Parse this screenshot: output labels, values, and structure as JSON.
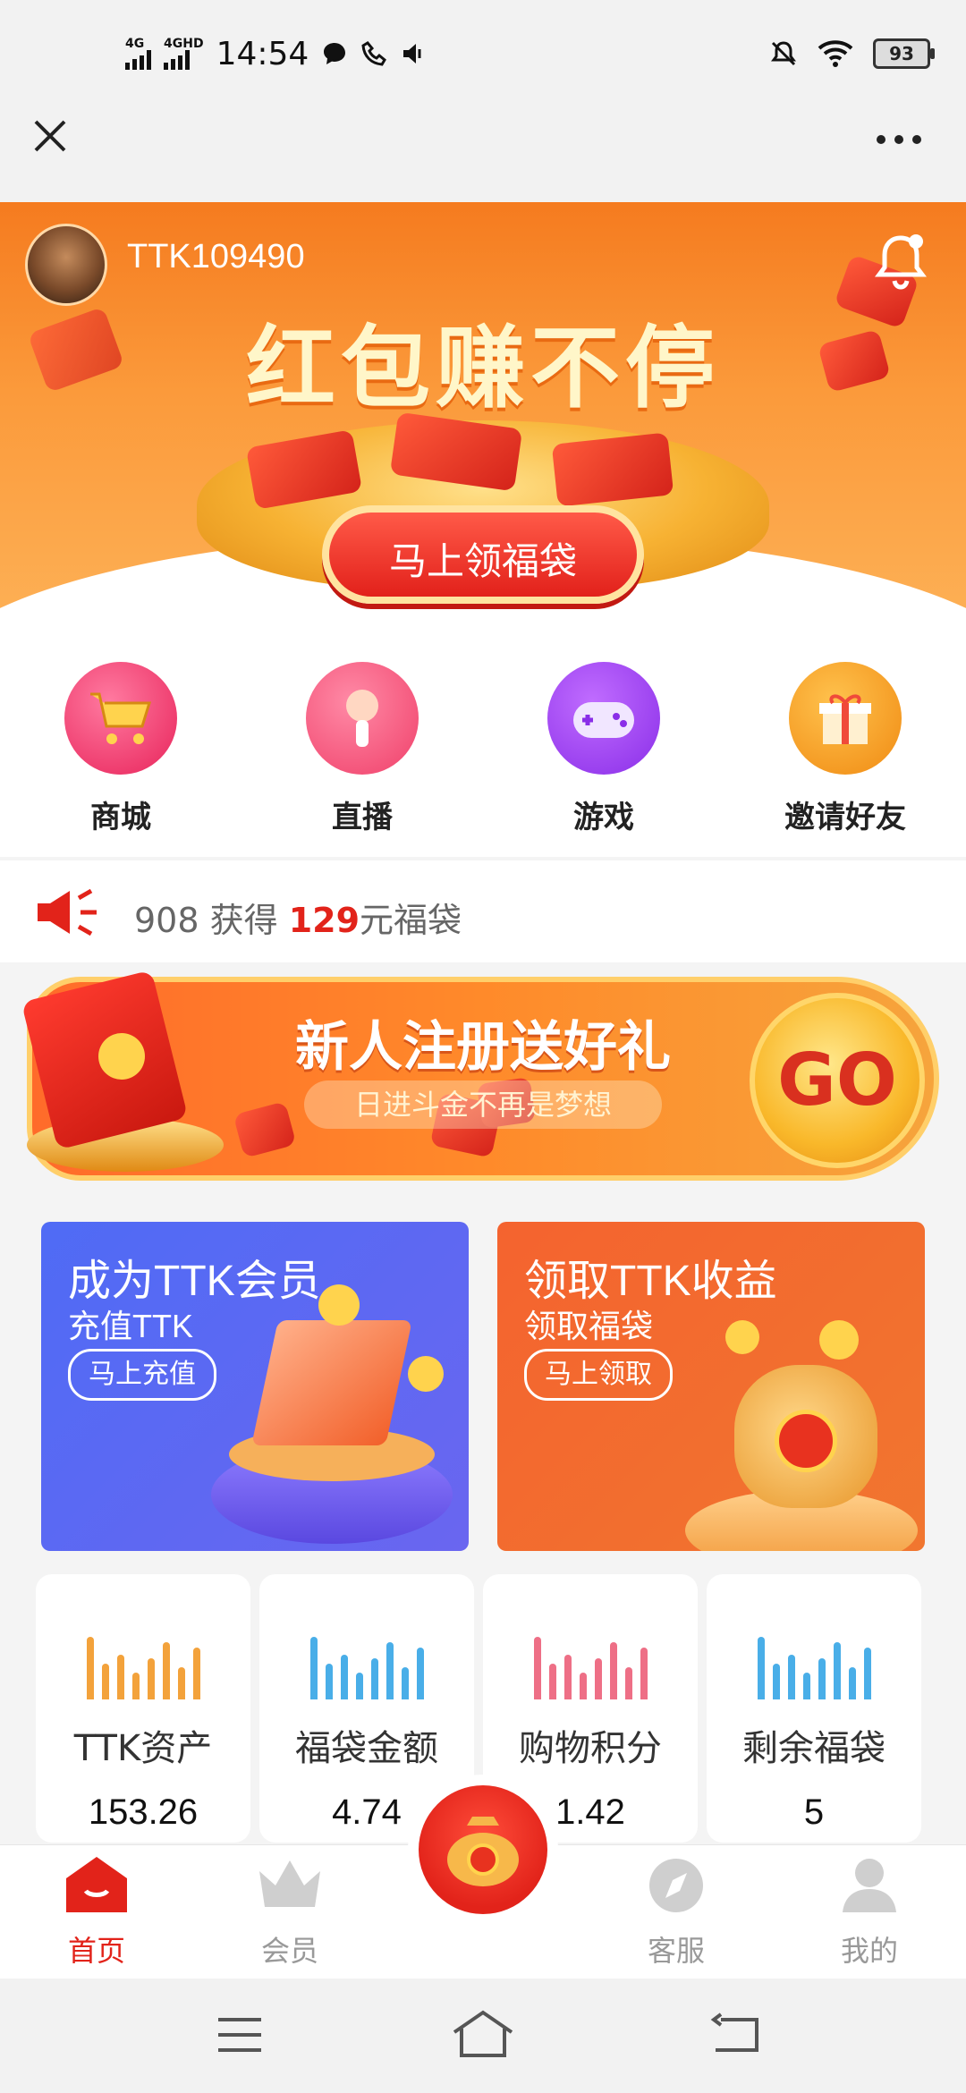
{
  "status_bar": {
    "network1": "4G",
    "network2": "4GHD",
    "time": "14:54",
    "battery": "93"
  },
  "top_nav": {
    "close_icon": "close-icon",
    "more_icon": "more-icon"
  },
  "hero": {
    "username": "TTK109490",
    "title": "红包赚不停",
    "button_label": "马上领福袋"
  },
  "grid_items": [
    {
      "label": "商城",
      "icon": "cart-icon",
      "color": "#f0407a"
    },
    {
      "label": "直播",
      "icon": "microphone-icon",
      "color": "#f5567a"
    },
    {
      "label": "游戏",
      "icon": "gamepad-icon",
      "color": "#a34ef0"
    },
    {
      "label": "邀请好友",
      "icon": "gift-icon",
      "color": "#f59b22"
    }
  ],
  "ticker": {
    "prefix": "908 获得 ",
    "amount": "129",
    "suffix": "元福袋"
  },
  "new_user_banner": {
    "title": "新人注册送好礼",
    "subtitle": "日进斗金不再是梦想",
    "go_label": "GO"
  },
  "cards": [
    {
      "title": "成为TTK会员",
      "subtitle": "充值TTK",
      "button": "马上充值"
    },
    {
      "title": "领取TTK收益",
      "subtitle": "领取福袋",
      "button": "马上领取"
    }
  ],
  "stats": [
    {
      "label": "TTK资产",
      "value": "153.26",
      "color": "#f3a23b"
    },
    {
      "label": "福袋金额",
      "value": "4.74",
      "color": "#49aee8"
    },
    {
      "label": "购物积分",
      "value": "1.42",
      "color": "#ee6f86"
    },
    {
      "label": "剩余福袋",
      "value": "5",
      "color": "#49aee8"
    }
  ],
  "bottom_nav": [
    {
      "label": "首页",
      "icon": "home-icon",
      "active": true
    },
    {
      "label": "会员",
      "icon": "crown-icon",
      "active": false
    },
    {
      "label": "客服",
      "icon": "compass-icon",
      "active": false
    },
    {
      "label": "我的",
      "icon": "profile-icon",
      "active": false
    }
  ],
  "system_nav": {
    "menu_icon": "menu-icon",
    "home_icon": "home-outline-icon",
    "back_icon": "back-icon"
  }
}
